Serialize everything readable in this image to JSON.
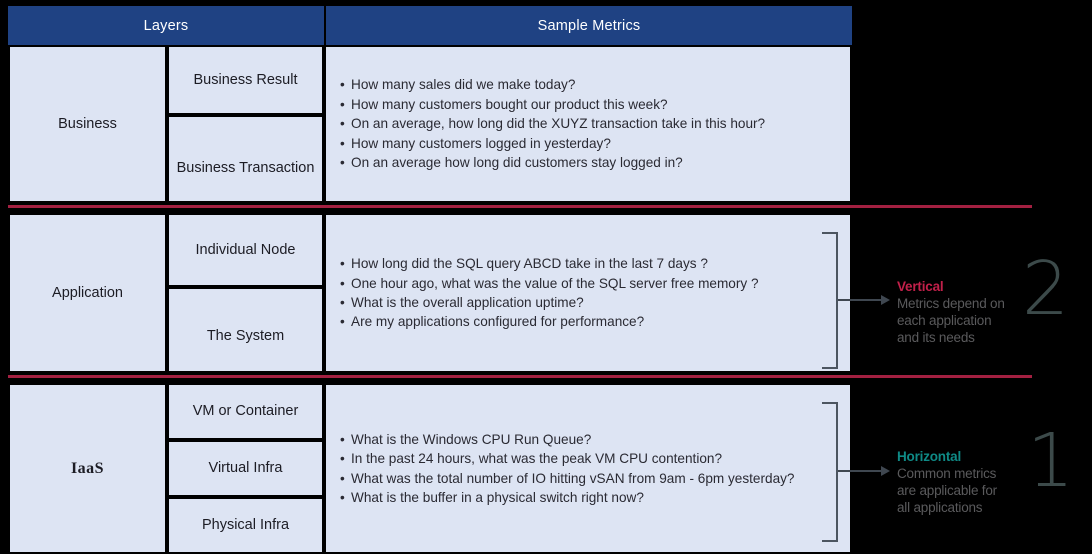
{
  "header": {
    "layers_label": "Layers",
    "metrics_label": "Sample Metrics"
  },
  "sections": [
    {
      "layer": "Business",
      "sublayers": [
        "Business Result",
        "Business Transaction"
      ],
      "metrics": [
        "How many sales did we make today?",
        "How many customers bought our product this week?",
        "On an average, how long did the XUYZ transaction take in this hour?",
        "How many customers logged in yesterday?",
        "On an average how long did customers stay logged in?"
      ]
    },
    {
      "layer": "Application",
      "sublayers": [
        "Individual Node",
        "The System"
      ],
      "metrics": [
        "How long did the SQL query ABCD take in the last 7 days ?",
        "One hour ago, what was the value of the SQL server free memory ?",
        "What is the overall application uptime?",
        "Are my applications configured for performance?"
      ]
    },
    {
      "layer": "IaaS",
      "sublayers": [
        "VM or Container",
        "Virtual Infra",
        "Physical Infra"
      ],
      "metrics": [
        "What is the Windows CPU Run Queue?",
        "In the past 24 hours, what was the peak VM CPU contention?",
        "What was the total number of IO hitting vSAN from 9am - 6pm yesterday?",
        "What is the buffer in a physical switch right now?"
      ]
    }
  ],
  "callouts": {
    "vertical": {
      "title": "Vertical",
      "line1": "Metrics depend on",
      "line2": "each application",
      "line3": "and its needs",
      "number": "2"
    },
    "horizontal": {
      "title": "Horizontal",
      "line1": "Common metrics",
      "line2": "are applicable for",
      "line3": "all applications",
      "number": "1"
    }
  },
  "colors": {
    "header_blue": "#1f4283",
    "cell_fill": "#dde4f3",
    "separator_crimson": "#a32041",
    "vertical_accent": "#c2204a",
    "horizontal_accent": "#0f8a86",
    "big_number": "#3c4a4a",
    "background": "#000000"
  }
}
